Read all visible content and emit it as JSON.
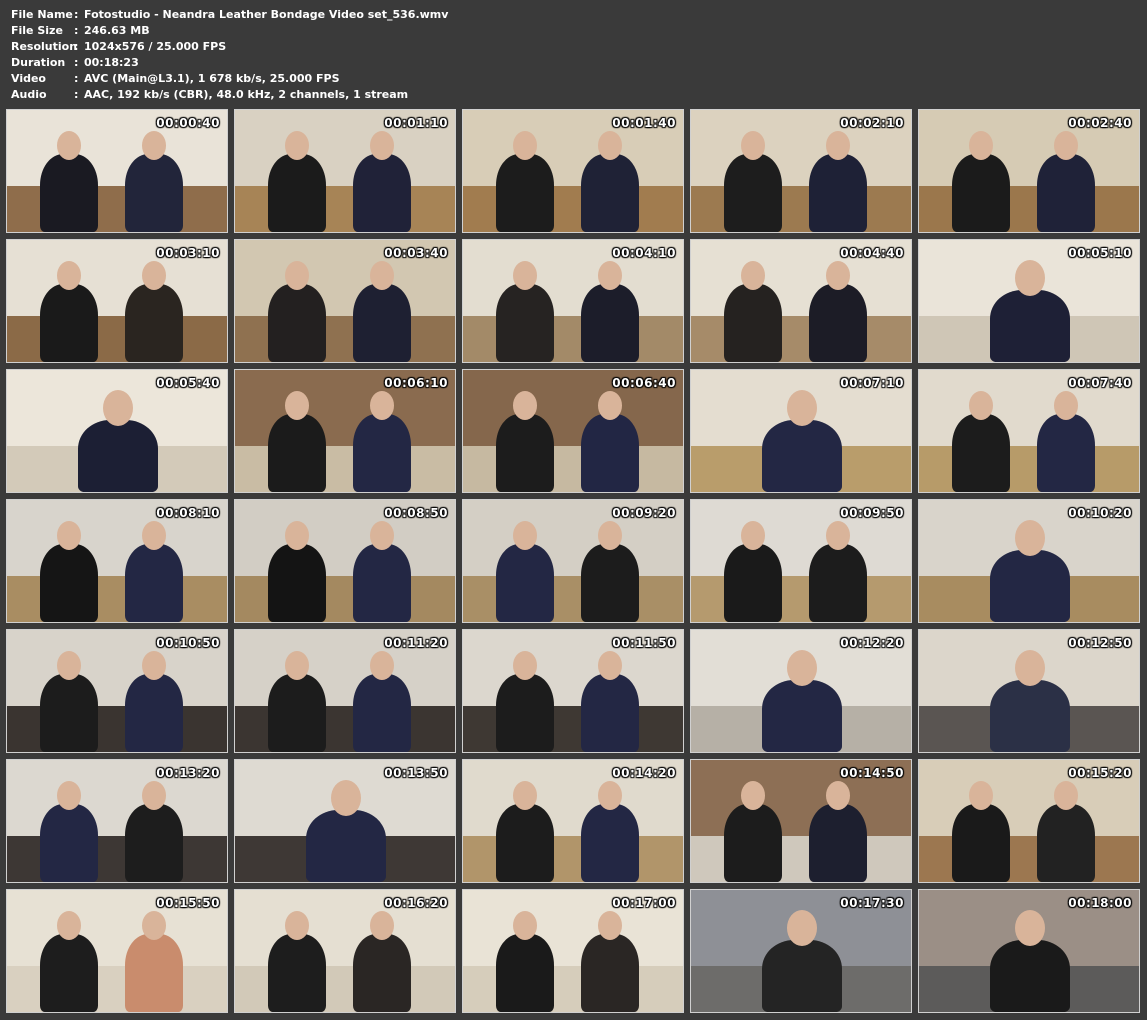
{
  "info": {
    "separator": ":",
    "rows": [
      {
        "label": "File Name",
        "value": "Fotostudio - Neandra Leather Bondage Video set_536.wmv"
      },
      {
        "label": "File Size",
        "value": "246.63 MB"
      },
      {
        "label": "Resolution",
        "value": "1024x576 / 25.000 FPS"
      },
      {
        "label": "Duration",
        "value": "00:18:23"
      },
      {
        "label": "Video",
        "value": "AVC (Main@L3.1), 1 678 kb/s, 25.000 FPS"
      },
      {
        "label": "Audio",
        "value": "AAC, 192 kb/s (CBR), 48.0 kHz, 2 channels, 1 stream"
      }
    ]
  },
  "thumbnails": [
    {
      "time": "00:00:40",
      "wall": "#e9e3d8",
      "floor": "#8f6d4b",
      "figs": [
        "#1a1a22",
        "#22253a"
      ]
    },
    {
      "time": "00:01:10",
      "wall": "#d9d1c2",
      "floor": "#a78456",
      "figs": [
        "#1b1b1b",
        "#202238"
      ]
    },
    {
      "time": "00:01:40",
      "wall": "#d8cdb7",
      "floor": "#a17c4f",
      "figs": [
        "#1c1c1c",
        "#1f2236"
      ]
    },
    {
      "time": "00:02:10",
      "wall": "#dcd2bf",
      "floor": "#9c7a50",
      "figs": [
        "#1d1d1d",
        "#1e2136"
      ]
    },
    {
      "time": "00:02:40",
      "wall": "#d6cbb4",
      "floor": "#9b774c",
      "figs": [
        "#1b1b1b",
        "#1f2238"
      ]
    },
    {
      "time": "00:03:10",
      "wall": "#e6e0d4",
      "floor": "#8b6a47",
      "figs": [
        "#1a1a1a",
        "#2a2520"
      ]
    },
    {
      "time": "00:03:40",
      "wall": "#d2c7b1",
      "floor": "#8f7150",
      "figs": [
        "#232020",
        "#1e2032"
      ]
    },
    {
      "time": "00:04:10",
      "wall": "#e3ddd0",
      "floor": "#a38a68",
      "figs": [
        "#262322",
        "#1c1d2a"
      ]
    },
    {
      "time": "00:04:40",
      "wall": "#e6e0d3",
      "floor": "#a68b69",
      "figs": [
        "#252220",
        "#1c1c26"
      ]
    },
    {
      "time": "00:05:10",
      "wall": "#eae4d9",
      "floor": "#cfc6b6",
      "figs": [
        "#1e2036"
      ]
    },
    {
      "time": "00:05:40",
      "wall": "#ece6da",
      "floor": "#d3cab9",
      "figs": [
        "#1c1f34"
      ]
    },
    {
      "time": "00:06:10",
      "wall": "#8a6b4f",
      "floor": "#c9bca4",
      "figs": [
        "#1b1b1b",
        "#232744"
      ]
    },
    {
      "time": "00:06:40",
      "wall": "#85674c",
      "floor": "#c6b9a1",
      "figs": [
        "#1c1c1c",
        "#222644"
      ]
    },
    {
      "time": "00:07:10",
      "wall": "#e4ddd0",
      "floor": "#b99d6b",
      "figs": [
        "#232744"
      ]
    },
    {
      "time": "00:07:40",
      "wall": "#e1dacd",
      "floor": "#b79b69",
      "figs": [
        "#1c1c1c",
        "#232744"
      ]
    },
    {
      "time": "00:08:10",
      "wall": "#d8d4cc",
      "floor": "#a98d62",
      "figs": [
        "#151515",
        "#232744"
      ]
    },
    {
      "time": "00:08:50",
      "wall": "#d2cdc4",
      "floor": "#a48960",
      "figs": [
        "#141414",
        "#232744"
      ]
    },
    {
      "time": "00:09:20",
      "wall": "#d4cfc5",
      "floor": "#a98f66",
      "figs": [
        "#232744",
        "#1c1c1c"
      ]
    },
    {
      "time": "00:09:50",
      "wall": "#dedad3",
      "floor": "#b59a6e",
      "figs": [
        "#1a1a1a",
        "#1c1c1c"
      ]
    },
    {
      "time": "00:10:20",
      "wall": "#d9d4cb",
      "floor": "#a88c60",
      "figs": [
        "#232744"
      ]
    },
    {
      "time": "00:10:50",
      "wall": "#d8d3ca",
      "floor": "#3a3430",
      "figs": [
        "#1c1c1c",
        "#232744"
      ]
    },
    {
      "time": "00:11:20",
      "wall": "#d6d1c8",
      "floor": "#3b3531",
      "figs": [
        "#1c1c1c",
        "#232744"
      ]
    },
    {
      "time": "00:11:50",
      "wall": "#dcd7ce",
      "floor": "#3e3833",
      "figs": [
        "#1c1c1c",
        "#232744"
      ]
    },
    {
      "time": "00:12:20",
      "wall": "#e2ded6",
      "floor": "#b6b0a6",
      "figs": [
        "#232744"
      ]
    },
    {
      "time": "00:12:50",
      "wall": "#dcd6cb",
      "floor": "#5a5552",
      "figs": [
        "#2b3046"
      ]
    },
    {
      "time": "00:13:20",
      "wall": "#dcd8d0",
      "floor": "#3d3734",
      "figs": [
        "#232744",
        "#1d1d1d"
      ]
    },
    {
      "time": "00:13:50",
      "wall": "#dedad2",
      "floor": "#3e3835",
      "figs": [
        "#232744"
      ]
    },
    {
      "time": "00:14:20",
      "wall": "#e0dacd",
      "floor": "#b1956a",
      "figs": [
        "#1c1c1c",
        "#232744"
      ]
    },
    {
      "time": "00:14:50",
      "wall": "#8d6f55",
      "floor": "#cfc8bc",
      "figs": [
        "#1c1c1c",
        "#1d1f2f"
      ]
    },
    {
      "time": "00:15:20",
      "wall": "#d8cdb8",
      "floor": "#9c7750",
      "figs": [
        "#1a1a1a",
        "#222222"
      ]
    },
    {
      "time": "00:15:50",
      "wall": "#e7e1d4",
      "floor": "#d9d0c0",
      "figs": [
        "#1d1d1d",
        "#c98c6d"
      ]
    },
    {
      "time": "00:16:20",
      "wall": "#e5dfd2",
      "floor": "#d2c9b8",
      "figs": [
        "#1d1d1d",
        "#2a2624"
      ]
    },
    {
      "time": "00:17:00",
      "wall": "#e9e3d6",
      "floor": "#d6cdbb",
      "figs": [
        "#1a1a1a",
        "#2a2624"
      ]
    },
    {
      "time": "00:17:30",
      "wall": "#8e9096",
      "floor": "#6d6c6a",
      "figs": [
        "#242424"
      ]
    },
    {
      "time": "00:18:00",
      "wall": "#9b8f86",
      "floor": "#5c5b5a",
      "figs": [
        "#1a1a1a"
      ]
    }
  ]
}
